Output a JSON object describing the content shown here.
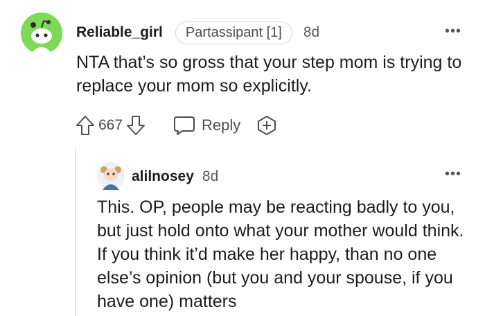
{
  "comment": {
    "username": "Reliable_girl",
    "flair": "Partassipant [1]",
    "age": "8d",
    "more_label": "•••",
    "body": "NTA that’s so gross that your step mom is trying to replace your mom so explicitly.",
    "votes": "667",
    "reply_label": "Reply",
    "avatar_icon": "reddit-snoo-avatar",
    "avatar_color": "#7ed957",
    "icons": [
      "upvote-arrow-icon",
      "downvote-arrow-icon",
      "chat-bubble-icon",
      "award-plus-icon"
    ]
  },
  "reply": {
    "username": "alilnosey",
    "age": "8d",
    "more_label": "•••",
    "body": "This. OP, people may be reacting badly to you, but just hold onto what your mother would think. If you think it’d make her happy, than no one else’s opinion (but you and your spouse, if you have one) matters",
    "avatar_icon": "custom-character-avatar"
  }
}
